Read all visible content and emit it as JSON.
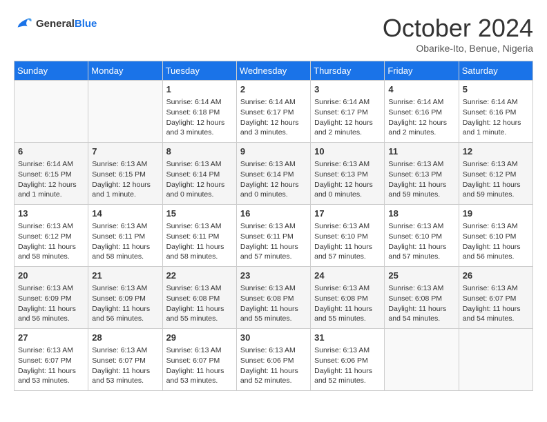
{
  "header": {
    "logo_line1": "General",
    "logo_line2": "Blue",
    "month": "October 2024",
    "location": "Obarike-Ito, Benue, Nigeria"
  },
  "days_of_week": [
    "Sunday",
    "Monday",
    "Tuesday",
    "Wednesday",
    "Thursday",
    "Friday",
    "Saturday"
  ],
  "weeks": [
    [
      {
        "day": "",
        "content": ""
      },
      {
        "day": "",
        "content": ""
      },
      {
        "day": "1",
        "content": "Sunrise: 6:14 AM\nSunset: 6:18 PM\nDaylight: 12 hours and 3 minutes."
      },
      {
        "day": "2",
        "content": "Sunrise: 6:14 AM\nSunset: 6:17 PM\nDaylight: 12 hours and 3 minutes."
      },
      {
        "day": "3",
        "content": "Sunrise: 6:14 AM\nSunset: 6:17 PM\nDaylight: 12 hours and 2 minutes."
      },
      {
        "day": "4",
        "content": "Sunrise: 6:14 AM\nSunset: 6:16 PM\nDaylight: 12 hours and 2 minutes."
      },
      {
        "day": "5",
        "content": "Sunrise: 6:14 AM\nSunset: 6:16 PM\nDaylight: 12 hours and 1 minute."
      }
    ],
    [
      {
        "day": "6",
        "content": "Sunrise: 6:14 AM\nSunset: 6:15 PM\nDaylight: 12 hours and 1 minute."
      },
      {
        "day": "7",
        "content": "Sunrise: 6:13 AM\nSunset: 6:15 PM\nDaylight: 12 hours and 1 minute."
      },
      {
        "day": "8",
        "content": "Sunrise: 6:13 AM\nSunset: 6:14 PM\nDaylight: 12 hours and 0 minutes."
      },
      {
        "day": "9",
        "content": "Sunrise: 6:13 AM\nSunset: 6:14 PM\nDaylight: 12 hours and 0 minutes."
      },
      {
        "day": "10",
        "content": "Sunrise: 6:13 AM\nSunset: 6:13 PM\nDaylight: 12 hours and 0 minutes."
      },
      {
        "day": "11",
        "content": "Sunrise: 6:13 AM\nSunset: 6:13 PM\nDaylight: 11 hours and 59 minutes."
      },
      {
        "day": "12",
        "content": "Sunrise: 6:13 AM\nSunset: 6:12 PM\nDaylight: 11 hours and 59 minutes."
      }
    ],
    [
      {
        "day": "13",
        "content": "Sunrise: 6:13 AM\nSunset: 6:12 PM\nDaylight: 11 hours and 58 minutes."
      },
      {
        "day": "14",
        "content": "Sunrise: 6:13 AM\nSunset: 6:11 PM\nDaylight: 11 hours and 58 minutes."
      },
      {
        "day": "15",
        "content": "Sunrise: 6:13 AM\nSunset: 6:11 PM\nDaylight: 11 hours and 58 minutes."
      },
      {
        "day": "16",
        "content": "Sunrise: 6:13 AM\nSunset: 6:11 PM\nDaylight: 11 hours and 57 minutes."
      },
      {
        "day": "17",
        "content": "Sunrise: 6:13 AM\nSunset: 6:10 PM\nDaylight: 11 hours and 57 minutes."
      },
      {
        "day": "18",
        "content": "Sunrise: 6:13 AM\nSunset: 6:10 PM\nDaylight: 11 hours and 57 minutes."
      },
      {
        "day": "19",
        "content": "Sunrise: 6:13 AM\nSunset: 6:10 PM\nDaylight: 11 hours and 56 minutes."
      }
    ],
    [
      {
        "day": "20",
        "content": "Sunrise: 6:13 AM\nSunset: 6:09 PM\nDaylight: 11 hours and 56 minutes."
      },
      {
        "day": "21",
        "content": "Sunrise: 6:13 AM\nSunset: 6:09 PM\nDaylight: 11 hours and 56 minutes."
      },
      {
        "day": "22",
        "content": "Sunrise: 6:13 AM\nSunset: 6:08 PM\nDaylight: 11 hours and 55 minutes."
      },
      {
        "day": "23",
        "content": "Sunrise: 6:13 AM\nSunset: 6:08 PM\nDaylight: 11 hours and 55 minutes."
      },
      {
        "day": "24",
        "content": "Sunrise: 6:13 AM\nSunset: 6:08 PM\nDaylight: 11 hours and 55 minutes."
      },
      {
        "day": "25",
        "content": "Sunrise: 6:13 AM\nSunset: 6:08 PM\nDaylight: 11 hours and 54 minutes."
      },
      {
        "day": "26",
        "content": "Sunrise: 6:13 AM\nSunset: 6:07 PM\nDaylight: 11 hours and 54 minutes."
      }
    ],
    [
      {
        "day": "27",
        "content": "Sunrise: 6:13 AM\nSunset: 6:07 PM\nDaylight: 11 hours and 53 minutes."
      },
      {
        "day": "28",
        "content": "Sunrise: 6:13 AM\nSunset: 6:07 PM\nDaylight: 11 hours and 53 minutes."
      },
      {
        "day": "29",
        "content": "Sunrise: 6:13 AM\nSunset: 6:07 PM\nDaylight: 11 hours and 53 minutes."
      },
      {
        "day": "30",
        "content": "Sunrise: 6:13 AM\nSunset: 6:06 PM\nDaylight: 11 hours and 52 minutes."
      },
      {
        "day": "31",
        "content": "Sunrise: 6:13 AM\nSunset: 6:06 PM\nDaylight: 11 hours and 52 minutes."
      },
      {
        "day": "",
        "content": ""
      },
      {
        "day": "",
        "content": ""
      }
    ]
  ]
}
